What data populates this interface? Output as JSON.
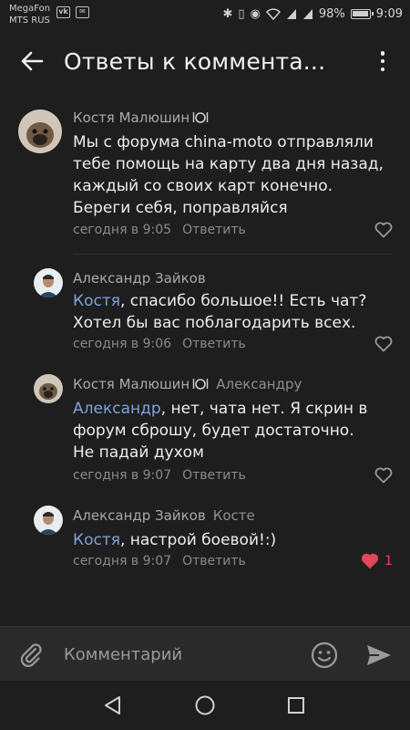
{
  "status_bar": {
    "carrier_1": "MegaFon",
    "carrier_2": "MTS RUS",
    "left_icons": [
      "vk-icon",
      "mail-icon"
    ],
    "right_icons": [
      "bluetooth-icon",
      "vibrate-icon",
      "eye-icon",
      "wifi-icon",
      "signal-icon",
      "signal-icon"
    ],
    "battery": "98%",
    "time": "9:09"
  },
  "app_bar": {
    "title": "Ответы к коммента..."
  },
  "comments": [
    {
      "author": "Костя Малюшин",
      "reply_to": "",
      "mention": "",
      "text": "Мы с форума china-moto отправляли тебе помощь на карту два дня назад, каждый со своих карт конечно. Береги себя, поправляйся",
      "time": "сегодня в 9:05",
      "reply_label": "Ответить",
      "likes": ""
    },
    {
      "author": "Александр Зайков",
      "reply_to": "",
      "mention": "Костя",
      "text": ", спасибо большое!! Есть чат? Хотел бы вас поблагодарить всех.",
      "time": "сегодня в 9:06",
      "reply_label": "Ответить",
      "likes": ""
    },
    {
      "author": "Костя Малюшин",
      "reply_to": "Александру",
      "mention": "Александр",
      "text": ", нет, чата нет. Я скрин в форум сброшу, будет достаточно. Не падай духом",
      "time": "сегодня в 9:07",
      "reply_label": "Ответить",
      "likes": ""
    },
    {
      "author": "Александр Зайков",
      "reply_to": "Косте",
      "mention": "Костя",
      "text": ", настрой боевой!:)",
      "time": "сегодня в 9:07",
      "reply_label": "Ответить",
      "likes": "1"
    }
  ],
  "composer": {
    "placeholder": "Комментарий"
  },
  "colors": {
    "background": "#1e1e1f",
    "mention": "#7fa3d6",
    "like_active": "#e0485a"
  }
}
